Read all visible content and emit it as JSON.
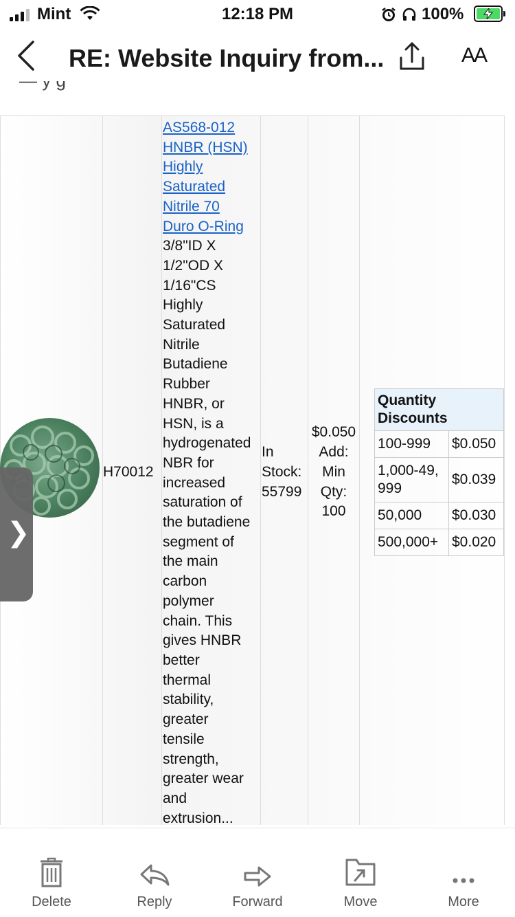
{
  "status_bar": {
    "carrier": "Mint",
    "time": "12:18 PM",
    "battery": "100%"
  },
  "header": {
    "subject": "RE: Website Inquiry from...",
    "text_size_label": "AA",
    "cut_text": "—  y  g"
  },
  "product": {
    "sku": "H70012",
    "link_lines": [
      "AS568-012",
      "HNBR (HSN)",
      "Highly",
      "Saturated",
      "Nitrile 70",
      "Duro O-Ring"
    ],
    "desc_lines": [
      "3/8\"ID X",
      "1/2\"OD X",
      "1/16\"CS",
      "Highly",
      "Saturated",
      "Nitrile",
      "Butadiene",
      "Rubber",
      "HNBR, or",
      "HSN, is a",
      "hydrogenated",
      "NBR for",
      "increased",
      "saturation of",
      "the butadiene",
      "segment of",
      "the main",
      "carbon",
      "polymer",
      "chain. This",
      "gives HNBR",
      "better",
      "thermal",
      "stability,",
      "greater",
      "tensile",
      "strength,",
      "greater wear",
      "and",
      "extrusion..."
    ],
    "stock_lines": [
      "In",
      "Stock:",
      "55799"
    ],
    "price_lines": [
      "$0.050",
      "Add:",
      "Min",
      "Qty:",
      "100"
    ]
  },
  "discounts": {
    "header": "Quantity Discounts",
    "rows": [
      {
        "qty": "100-999",
        "price": "$0.050"
      },
      {
        "qty": "1,000-49,999",
        "price": "$0.039"
      },
      {
        "qty": "50,000",
        "price": "$0.030"
      },
      {
        "qty": "500,000+",
        "price": "$0.020"
      }
    ]
  },
  "toolbar": {
    "delete": "Delete",
    "reply": "Reply",
    "forward": "Forward",
    "move": "Move",
    "more": "More"
  },
  "colors": {
    "link": "#1a62c7",
    "discount_header_bg": "#e8f2fb",
    "battery_green": "#4cd964",
    "icon_gray": "#777777"
  },
  "icons": {
    "back": "chevron-left-icon",
    "share": "share-icon",
    "delete": "trash-icon",
    "reply": "reply-arrow-icon",
    "forward": "forward-arrow-icon",
    "move": "move-folder-icon",
    "more": "ellipsis-icon"
  }
}
